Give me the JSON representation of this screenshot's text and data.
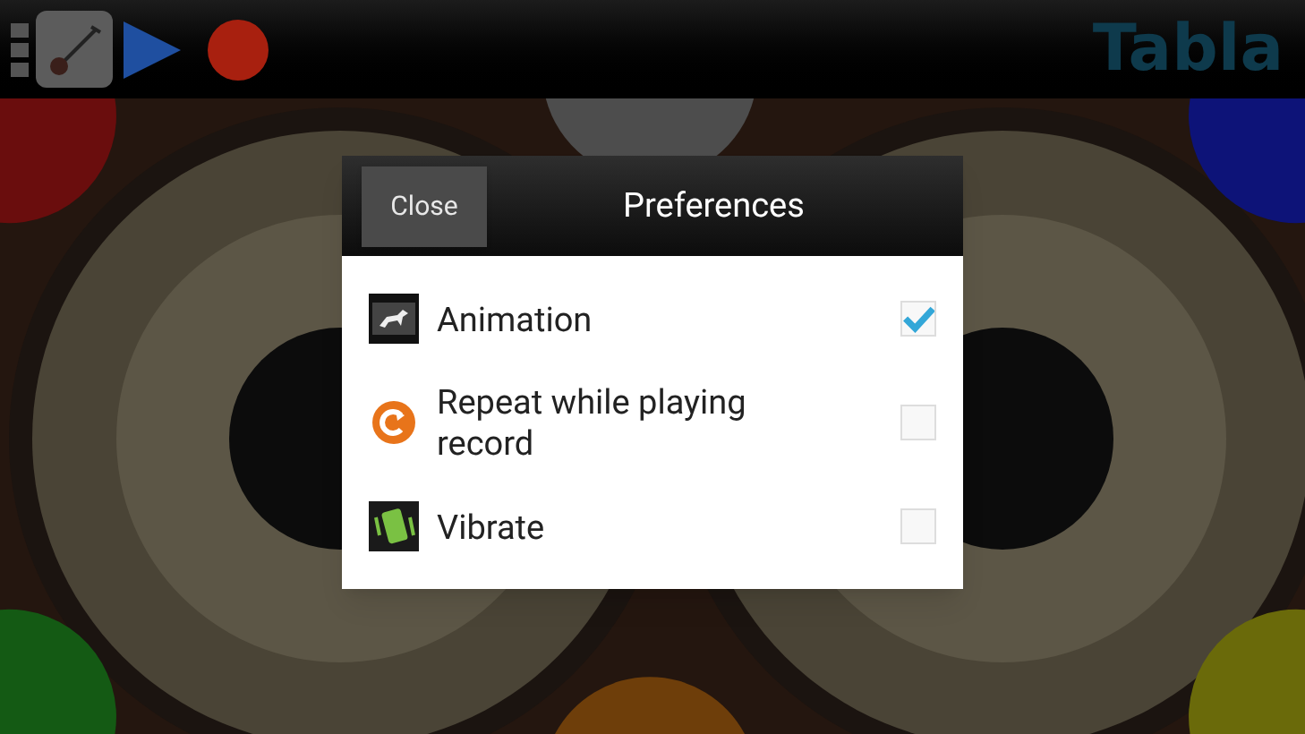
{
  "toolbar": {
    "logo": "Tabla"
  },
  "dialog": {
    "close_button": "Close",
    "title": "Preferences",
    "items": [
      {
        "label": "Animation",
        "checked": true
      },
      {
        "label": "Repeat while playing record",
        "checked": false
      },
      {
        "label": "Vibrate",
        "checked": false
      }
    ]
  }
}
